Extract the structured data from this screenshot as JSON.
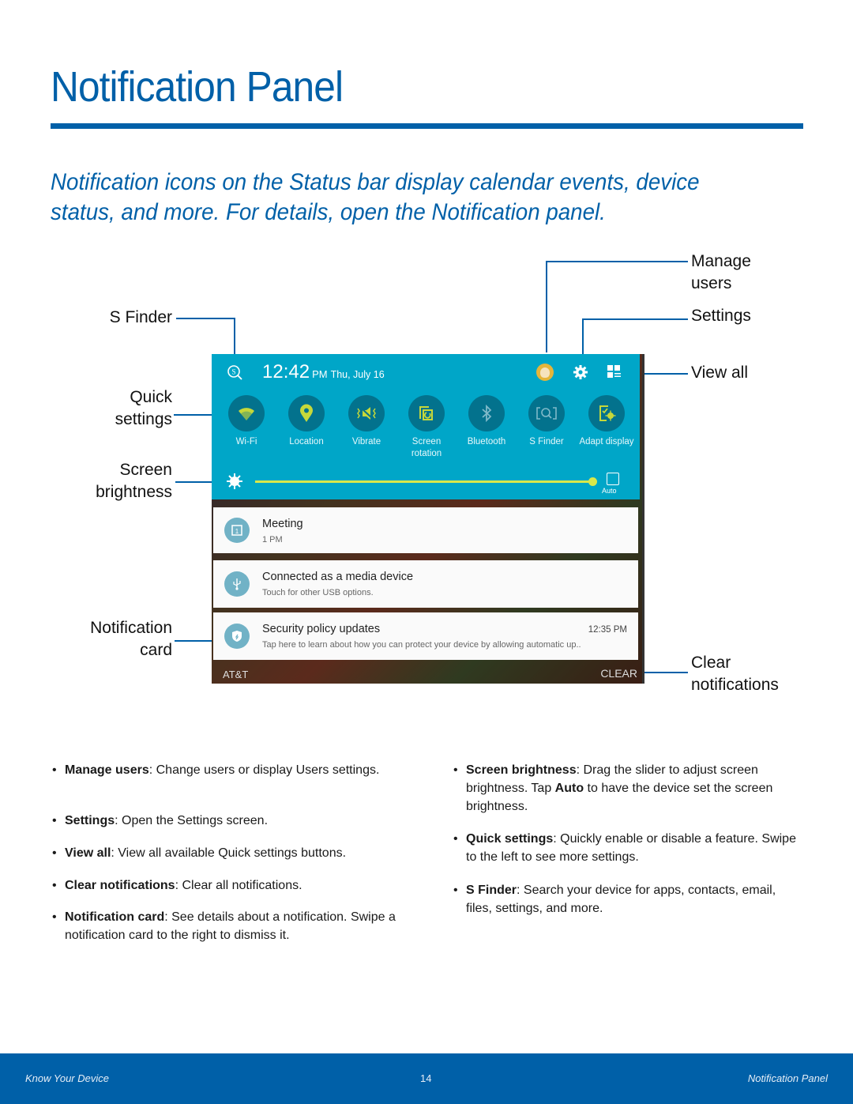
{
  "page": {
    "title": "Notification Panel",
    "intro": "Notification icons on the Status bar display calendar events, device status, and more. For details, open the Notification panel.",
    "accent_color": "#0060a8"
  },
  "callouts": {
    "s_finder": "S Finder",
    "quick_settings_1": "Quick",
    "quick_settings_2": "settings",
    "screen_brightness_1": "Screen",
    "screen_brightness_2": "brightness",
    "notification_card_1": "Notification",
    "notification_card_2": "card",
    "manage_users_1": "Manage",
    "manage_users_2": "users",
    "settings": "Settings",
    "view_all": "View all",
    "clear_notifications_1": "Clear",
    "clear_notifications_2": "notifications"
  },
  "device": {
    "panel_color": "#00a6c8",
    "toggle_active_color": "#c6d83a",
    "header": {
      "time": "12:42",
      "ampm": "PM",
      "date": "Thu, July 16",
      "icons": [
        "s-finder-icon",
        "user-avatar-icon",
        "settings-gear-icon",
        "view-all-grid-icon"
      ]
    },
    "quick_settings": [
      {
        "label": "Wi-Fi",
        "icon": "wifi-icon",
        "active": true
      },
      {
        "label": "Location",
        "icon": "location-pin-icon",
        "active": true
      },
      {
        "label": "Vibrate",
        "icon": "vibrate-icon",
        "active": true
      },
      {
        "label": "Screen rotation",
        "icon": "screen-rotation-icon",
        "active": true
      },
      {
        "label": "Bluetooth",
        "icon": "bluetooth-icon",
        "active": false
      },
      {
        "label": "S Finder",
        "icon": "s-finder-icon",
        "active": false
      },
      {
        "label": "Adapt display",
        "icon": "adapt-display-icon",
        "active": true
      }
    ],
    "brightness": {
      "level_percent": 100,
      "auto_label": "Auto",
      "auto_checked": false
    },
    "notifications": [
      {
        "title": "Meeting",
        "subtitle": "1 PM",
        "time": "",
        "icon": "calendar-icon"
      },
      {
        "title": "Connected as a media device",
        "subtitle": "Touch for other USB options.",
        "time": "",
        "icon": "usb-icon"
      },
      {
        "title": "Security policy updates",
        "subtitle": "Tap here to learn about how you can protect your device by allowing automatic up..",
        "time": "12:35 PM",
        "icon": "security-shield-icon"
      }
    ],
    "carrier": "AT&T",
    "clear_label": "CLEAR"
  },
  "bullets_left": [
    {
      "term": "Manage users",
      "text": ": Change users or display Users settings."
    },
    {
      "term": "Settings",
      "text": ": Open the Settings screen."
    },
    {
      "term": "View all",
      "text": ": View all available Quick settings buttons."
    },
    {
      "term": "Clear notifications",
      "text": ": Clear all notifications."
    },
    {
      "term": "Notification card",
      "text": ": See details about a notification. Swipe a notification card to the right to dismiss it."
    }
  ],
  "bullets_right": [
    {
      "term": "Screen brightness",
      "text_before": ": Drag the slider to adjust screen brightness. Tap ",
      "term2": "Auto",
      "text": " to have the device set the screen brightness."
    },
    {
      "term": "Quick settings",
      "text": ": Quickly enable or disable a feature. Swipe to the left to see more settings."
    },
    {
      "term": "S Finder",
      "text": ": Search your device for apps, contacts, email, files, settings, and more."
    }
  ],
  "footer": {
    "section": "Know Your Device",
    "page_number": "14",
    "chapter": "Notification Panel"
  }
}
